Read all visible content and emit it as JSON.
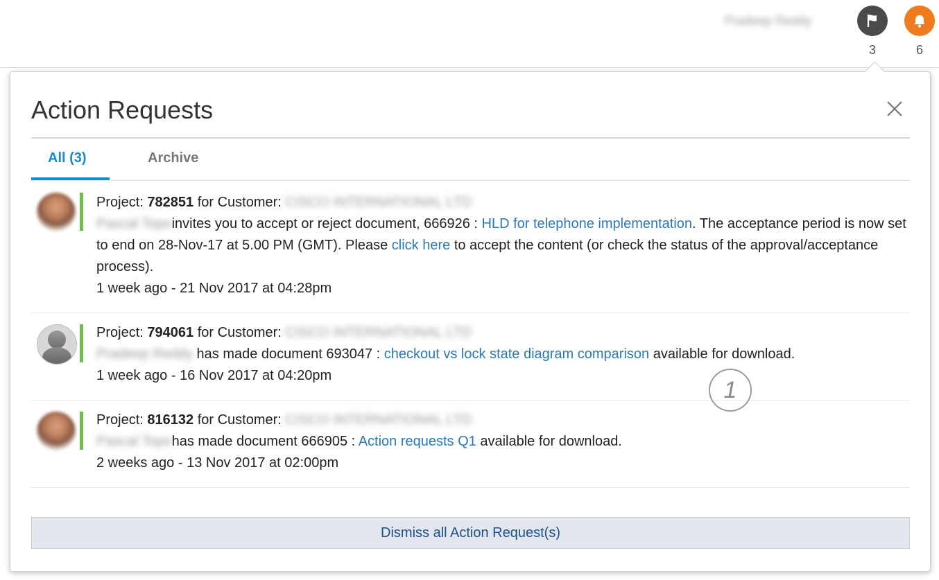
{
  "header": {
    "user_name": "Pradeep Reddy",
    "flag_count": "3",
    "bell_count": "6",
    "flag_color": "#4a4a4a",
    "bell_color": "#f07c20",
    "icons": [
      "flag-icon",
      "bell-icon"
    ]
  },
  "panel": {
    "title": "Action Requests",
    "close_icon": "close-icon",
    "tabs": [
      {
        "label": "All (3)",
        "active": true
      },
      {
        "label": "Archive",
        "active": false
      }
    ],
    "accent_color": "#1a8ad0",
    "status_color": "#6cc04a"
  },
  "requests": [
    {
      "project_label": "Project:",
      "project_number": "782851",
      "customer_label": "for Customer:",
      "customer_name": "CISCO INTERNATIONAL LTD",
      "actor": "Pascal Topo",
      "text_before_link": "invites you to accept or reject document, 666926 :",
      "link_text": "HLD for telephone implementation",
      "text_after_link": ". The acceptance period is now set to end on 28-Nov-17 at 5.00 PM (GMT). Please",
      "link2_text": "click here",
      "text_after_link2": "to accept the content (or check the status of the approval/acceptance process).",
      "timestamp": "1 week ago - 21 Nov 2017 at 04:28pm"
    },
    {
      "project_label": "Project:",
      "project_number": "794061",
      "customer_label": "for Customer:",
      "customer_name": "CISCO INTERNATIONAL LTD",
      "actor": "Pradeep Reddy",
      "text_before_link": "has made document 693047 :",
      "link_text": "checkout vs lock state diagram comparison",
      "text_after_link": "available for download.",
      "timestamp": "1 week ago - 16 Nov 2017 at 04:20pm"
    },
    {
      "project_label": "Project:",
      "project_number": "816132",
      "customer_label": "for Customer:",
      "customer_name": "CISCO INTERNATIONAL LTD",
      "actor": "Pascal Topo",
      "text_before_link": "has made document 666905 :",
      "link_text": "Action requests Q1",
      "text_after_link": "available for download.",
      "timestamp": "2 weeks ago - 13 Nov 2017 at 02:00pm"
    }
  ],
  "annotation_number": "1",
  "dismiss_label": "Dismiss all Action Request(s)"
}
